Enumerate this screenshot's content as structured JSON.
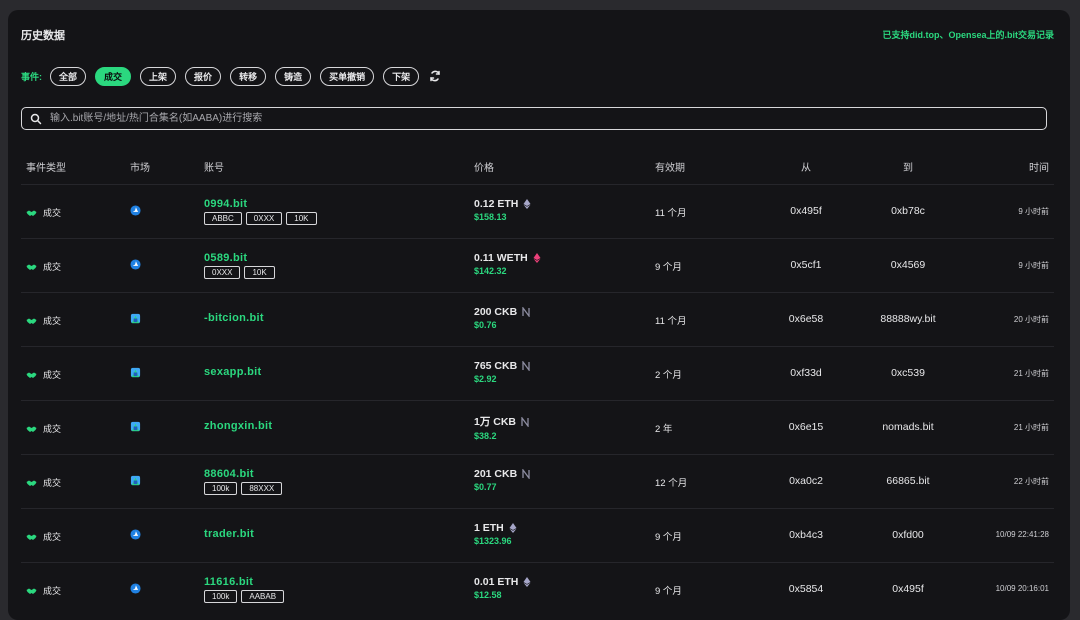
{
  "header": {
    "title": "历史数据",
    "support_note": "已支持did.top、Opensea上的.bit交易记录"
  },
  "events": {
    "label": "事件:",
    "chips": [
      {
        "label": "全部",
        "active": false
      },
      {
        "label": "成交",
        "active": true
      },
      {
        "label": "上架",
        "active": false
      },
      {
        "label": "报价",
        "active": false
      },
      {
        "label": "转移",
        "active": false
      },
      {
        "label": "铸造",
        "active": false
      },
      {
        "label": "买单撤销",
        "active": false
      },
      {
        "label": "下架",
        "active": false
      }
    ]
  },
  "search": {
    "placeholder": "输入.bit账号/地址/热门合集名(如AABA)进行搜索",
    "value": ""
  },
  "columns": {
    "type": "事件类型",
    "market": "市场",
    "account": "账号",
    "price": "价格",
    "validity": "有效期",
    "from": "从",
    "to": "到",
    "time": "时间"
  },
  "rows": [
    {
      "event": "成交",
      "market": "marketplace-icon",
      "account": "0994.bit",
      "tags": [
        "ABBC",
        "0XXX",
        "10K"
      ],
      "price": "0.12 ETH",
      "currency": "ETH",
      "usd": "$158.13",
      "validity": "11 个月",
      "from": "0x495f",
      "to": "0xb78c",
      "time": "9 小时前"
    },
    {
      "event": "成交",
      "market": "marketplace-icon",
      "account": "0589.bit",
      "tags": [
        "0XXX",
        "10K"
      ],
      "price": "0.11 WETH",
      "currency": "WETH",
      "usd": "$142.32",
      "validity": "9 个月",
      "from": "0x5cf1",
      "to": "0x4569",
      "time": "9 小时前"
    },
    {
      "event": "成交",
      "market": "didtop-icon",
      "account": "-bitcion.bit",
      "tags": [],
      "price": "200 CKB",
      "currency": "CKB",
      "usd": "$0.76",
      "validity": "11 个月",
      "from": "0x6e58",
      "to": "88888wy.bit",
      "time": "20 小时前"
    },
    {
      "event": "成交",
      "market": "didtop-icon",
      "account": "sexapp.bit",
      "tags": [],
      "price": "765 CKB",
      "currency": "CKB",
      "usd": "$2.92",
      "validity": "2 个月",
      "from": "0xf33d",
      "to": "0xc539",
      "time": "21 小时前"
    },
    {
      "event": "成交",
      "market": "didtop-icon",
      "account": "zhongxin.bit",
      "tags": [],
      "price": "1万 CKB",
      "currency": "CKB",
      "usd": "$38.2",
      "validity": "2 年",
      "from": "0x6e15",
      "to": "nomads.bit",
      "time": "21 小时前"
    },
    {
      "event": "成交",
      "market": "didtop-icon",
      "account": "88604.bit",
      "tags": [
        "100k",
        "88XXX"
      ],
      "price": "201 CKB",
      "currency": "CKB",
      "usd": "$0.77",
      "validity": "12 个月",
      "from": "0xa0c2",
      "to": "66865.bit",
      "time": "22 小时前"
    },
    {
      "event": "成交",
      "market": "marketplace-icon",
      "account": "trader.bit",
      "tags": [],
      "price": "1 ETH",
      "currency": "ETH",
      "usd": "$1323.96",
      "validity": "9 个月",
      "from": "0xb4c3",
      "to": "0xfd00",
      "time": "10/09 22:41:28"
    },
    {
      "event": "成交",
      "market": "marketplace-icon",
      "account": "11616.bit",
      "tags": [
        "100k",
        "AABAB"
      ],
      "price": "0.01 ETH",
      "currency": "ETH",
      "usd": "$12.58",
      "validity": "9 个月",
      "from": "0x5854",
      "to": "0x495f",
      "time": "10/09 20:16:01"
    }
  ],
  "colors": {
    "accent": "#2bd87f",
    "background": "#141417",
    "opensea": "#2081e2",
    "weth": "#ec407a"
  }
}
